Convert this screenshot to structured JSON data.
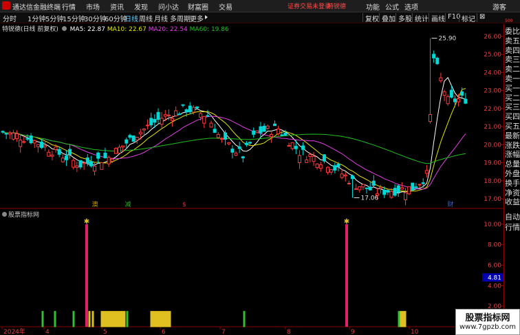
{
  "app": {
    "title": "通达信金融终端",
    "menus": [
      "行情",
      "市场",
      "资讯",
      "发现",
      "问小达",
      "财富圈",
      "交易"
    ],
    "login_warning": "证券交易未登录",
    "stock_tab": "特锐德",
    "right_menus": [
      "功能",
      "公式",
      "选项",
      "游客"
    ]
  },
  "toolbar": {
    "periods": [
      "分时",
      "1分钟",
      "5分钟",
      "15分钟",
      "30分钟",
      "60分钟",
      "日线",
      "周线",
      "月线",
      "多周期",
      "更多"
    ],
    "active": "日线",
    "right_buttons": [
      "复权",
      "叠加",
      "多股",
      "统计",
      "画线",
      "F10",
      "标记",
      "⊠"
    ]
  },
  "chart_info": {
    "name": "特锐德(日线 前复权)",
    "ma5": "MA5: 22.87",
    "ma10": "MA10: 22.67",
    "ma20": "MA20: 22.54",
    "ma60": "MA60: 19.86"
  },
  "colors": {
    "up": "#ff3b3b",
    "down": "#00d8d8",
    "ma5": "#ffffff",
    "ma10": "#e6e600",
    "ma20": "#e040e0",
    "ma60": "#20c020",
    "axis": "#e04040"
  },
  "price_axis": [
    "26.00",
    "25.00",
    "24.00",
    "23.00",
    "22.00",
    "21.00",
    "20.00",
    "19.00",
    "18.00",
    "17.00"
  ],
  "high_label": "25.90",
  "low_label": "17.06",
  "events": [
    "澳",
    "减",
    "$",
    "财"
  ],
  "right_panel": [
    "委比",
    "卖五",
    "卖四",
    "卖三",
    "卖二",
    "卖一",
    "买一",
    "买二",
    "买三",
    "买四",
    "买五",
    "最新",
    "涨跌",
    "涨幅",
    "总量",
    "外盘",
    "换手",
    "净资",
    "收益"
  ],
  "right_panel2": [
    "自动",
    "行情"
  ],
  "scale_label": "500",
  "indicator": {
    "title": "股票指标网",
    "axis": [
      "10.00",
      "8.00",
      "6.00",
      "4.00",
      "2.00"
    ],
    "current": "4.81"
  },
  "date_axis": [
    "2024年",
    "4",
    "5",
    "6",
    "7",
    "8",
    "9",
    "10"
  ],
  "watermark": {
    "line1": "股票指标网",
    "line2": "www.7gpzb.com"
  }
}
